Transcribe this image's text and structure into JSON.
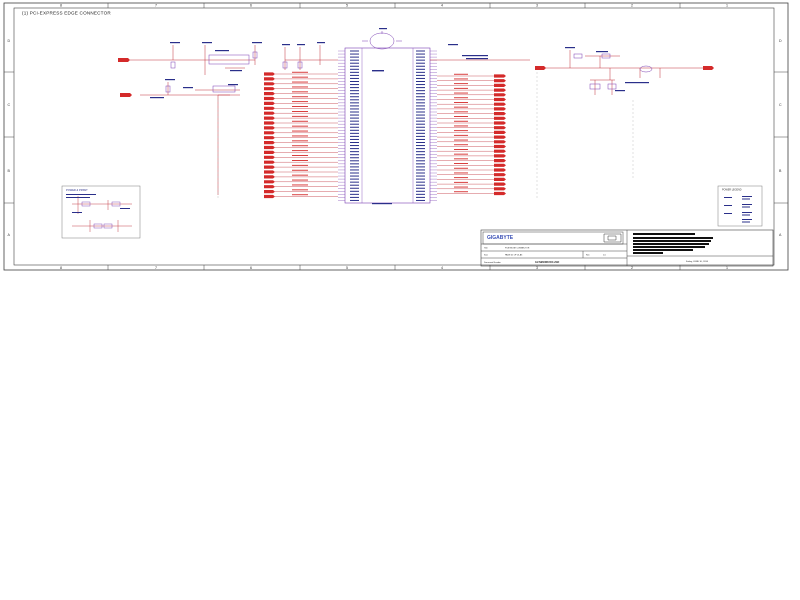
{
  "sheet": {
    "title": "(1) PCI-EXPRESS EDGE CONNECTOR",
    "border_columns": [
      "8",
      "7",
      "6",
      "5",
      "4",
      "3",
      "2",
      "1"
    ],
    "border_rows": [
      "D",
      "C",
      "B",
      "A"
    ]
  },
  "title_block": {
    "brand": "GIGABYTE",
    "rows": [
      {
        "label": "Title",
        "value": "PCIE EDGE CONNECTOR"
      },
      {
        "label": "Size",
        "value": "PAGE 01 OF 01 A3",
        "extra": "Rev",
        "extra_value": "1.0"
      },
      {
        "label": "Document Number",
        "value": "GV-N960WF2OC-2GD"
      }
    ],
    "footer_text": "Friday, JUNE 10, 2016"
  },
  "notes": {
    "left_box_title": "POWER & PRSNT",
    "legend_box_title": "POWER LEGEND"
  },
  "colors": {
    "wire": "#c0303a",
    "net_label": "#d42a2a",
    "component": "#7a3fb2",
    "text": "#2a2f8a",
    "border": "#404040",
    "brand": "#3a4fb5"
  }
}
